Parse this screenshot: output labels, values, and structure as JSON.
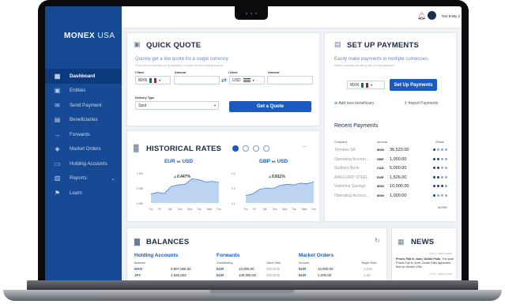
{
  "brand": {
    "name": "MONEX",
    "suffix": "USA"
  },
  "topbar": {
    "user_name": "Test Entity 2"
  },
  "sidebar": {
    "items": [
      {
        "label": "Dashboard",
        "icon": "grid-icon",
        "active": true
      },
      {
        "label": "Entities",
        "icon": "building-icon"
      },
      {
        "label": "Send Payment",
        "icon": "send-payment-icon"
      },
      {
        "label": "Beneficiaries",
        "icon": "person-card-icon"
      },
      {
        "label": "Forwards",
        "icon": "arrow-right-box-icon"
      },
      {
        "label": "Market Orders",
        "icon": "layers-icon"
      },
      {
        "label": "Holding Accounts",
        "icon": "folder-icon"
      },
      {
        "label": "Reports",
        "icon": "report-icon"
      },
      {
        "label": "Learn",
        "icon": "learn-icon"
      }
    ]
  },
  "quick_quote": {
    "title": "QUICK QUOTE",
    "subtitle": "Quickly get a live quote for a single currency.",
    "helper": "From here you can buy, set up payments, or place into your holding account.",
    "i_have_label": "I Have",
    "amount_label": "Amount",
    "i_need_label": "I Need",
    "amount2_label": "Amount",
    "from_currency": "MXN",
    "to_currency": "USD",
    "delivery_label": "Delivery Type",
    "delivery_value": "Spot",
    "button": "Get a Quote"
  },
  "setup_payments": {
    "title": "SET UP PAYMENTS",
    "subtitle": "Easily make payments in multiple currencies.",
    "helper": "Select a currency and set up one or more payments.",
    "currency": "MXN",
    "button": "Set Up Payments",
    "add_beneficiary": "Add new beneficiary",
    "import_payments": "Import Payments"
  },
  "recent_payments": {
    "title": "Recent Payments",
    "headers": [
      "Company",
      "Amount",
      "Status"
    ],
    "rows": [
      {
        "company": "Tomatos SA",
        "ccy": "MXN",
        "amount": "36,523.00",
        "status": 1
      },
      {
        "company": "Operating Accoun...",
        "ccy": "GBP",
        "amount": "1,000.00",
        "status": 2
      },
      {
        "company": "Sudbury Bank",
        "ccy": "CAD",
        "amount": "5,000.00",
        "status": 2
      },
      {
        "company": "AAA EURO STEEL",
        "ccy": "EUR",
        "amount": "1,526.00",
        "status": 2
      },
      {
        "company": "Valentine Savings",
        "ccy": "MXN",
        "amount": "10,000.00",
        "status": 3
      },
      {
        "company": "Operating Accoun...",
        "ccy": "MXN",
        "amount": "1,000.00",
        "status": 1
      }
    ],
    "more": "MORE"
  },
  "historical_rates": {
    "title": "HISTORICAL RATES",
    "menu": "...",
    "charts": [
      {
        "base": "EUR",
        "vs": "vs",
        "quote": "USD",
        "change": "0.447%",
        "yticks": [
          "1.100",
          "1.095",
          "1.090"
        ],
        "xticks": [
          "Thu",
          "Fri",
          "Sat",
          "Sun",
          "Mon",
          "Tue",
          "Wed",
          "Thu"
        ]
      },
      {
        "base": "GBP",
        "vs": "vs",
        "quote": "USD",
        "change": "0.811%",
        "yticks": [
          "1.3",
          "1.2",
          "1.1"
        ],
        "xticks": [
          "Thu",
          "Fri",
          "Sat",
          "Sun",
          "Mon",
          "Tue",
          "Wed",
          "Thu"
        ]
      }
    ]
  },
  "balances": {
    "title": "BALANCES",
    "holding": {
      "title": "Holding Accounts",
      "header": "Balance",
      "rows": [
        [
          "MXN",
          "9,807,056.50"
        ],
        [
          "JPY",
          "2,925,653"
        ]
      ]
    },
    "forwards": {
      "title": "Forwards",
      "headers": [
        "Outstanding",
        "Value Date"
      ],
      "rows": [
        [
          "EUR",
          "10,000.00",
          "3/6/2025"
        ],
        [
          "EUR",
          "100,000.00",
          "3/6/2025"
        ]
      ]
    },
    "market_orders": {
      "title": "Market Orders",
      "headers": [
        "Amount",
        "Target Rate"
      ],
      "rows": [
        [
          "EUR",
          "10,000.00",
          "1.065"
        ],
        [
          "EUR",
          "1,000.00",
          "1.08"
        ]
      ]
    }
  },
  "news": {
    "title": "NEWS",
    "date1": "JULY 1, 2024 9:00AM",
    "headline": "Prices Fall in June, Dollar Falls:",
    "body": "The post Prices Fall in June, Dollar Falls appeared first on Monex USA.",
    "date2": "JULY 1, 2024 9:00AM"
  },
  "colors": {
    "sidebar": "#164a95",
    "accent": "#1a5bc1",
    "chart_fill": "#bcd4f2",
    "positive": "#2aa84a"
  }
}
